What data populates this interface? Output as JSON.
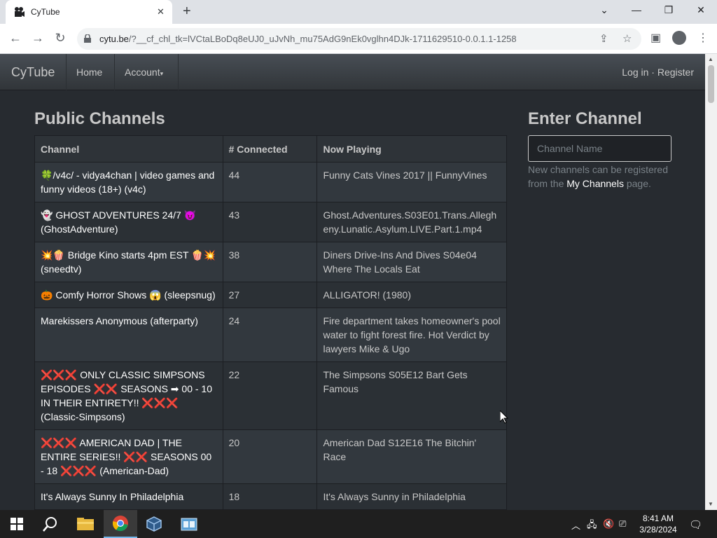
{
  "browser": {
    "tab_title": "CyTube",
    "url_host": "cytu.be",
    "url_path": "/?__cf_chl_tk=lVCtaLBoDq8eUJ0_uJvNh_mu75AdG9nEk0vglhn4DJk-1711629510-0.0.1.1-1258"
  },
  "navbar": {
    "brand": "CyTube",
    "home": "Home",
    "account": "Account",
    "login": "Log in",
    "separator": "·",
    "register": "Register"
  },
  "public": {
    "heading": "Public Channels",
    "columns": [
      "Channel",
      "# Connected",
      "Now Playing"
    ],
    "rows": [
      {
        "emoji_pre": "🍀",
        "name": "/v4c/ - vidya4chan | video games and funny videos (18+) (v4c)",
        "connected": "44",
        "now_playing": "Funny Cats Vines 2017 || FunnyVines"
      },
      {
        "emoji_pre": "👻",
        "name": "GHOST ADVENTURES 24/7 😈 (GhostAdventure)",
        "connected": "43",
        "now_playing": "Ghost.Adventures.S03E01.Trans.Allegheny.Lunatic.Asylum.LIVE.Part.1.mp4"
      },
      {
        "emoji_pre": "💥🍿",
        "name": "Bridge Kino starts 4pm EST 🍿💥 (sneedtv)",
        "connected": "38",
        "now_playing": "Diners Drive-Ins And Dives S04e04 Where The Locals Eat"
      },
      {
        "emoji_pre": "🎃",
        "name": "Comfy Horror Shows 😱 (sleepsnug)",
        "connected": "27",
        "now_playing": "ALLIGATOR! (1980)"
      },
      {
        "emoji_pre": "",
        "name": "Marekissers Anonymous (afterparty)",
        "connected": "24",
        "now_playing": "Fire department takes homeowner's pool water to fight forest fire. Hot Verdict by lawyers Mike & Ugo"
      },
      {
        "emoji_pre": "❌❌❌",
        "name": "ONLY CLASSIC SIMPSONS EPISODES ❌❌ SEASONS ➡ 00 - 10 IN THEIR ENTIRETY!! ❌❌❌ (Classic-Simpsons)",
        "connected": "22",
        "now_playing": "The Simpsons S05E12 Bart Gets Famous"
      },
      {
        "emoji_pre": "❌❌❌",
        "name": "AMERICAN DAD | THE ENTIRE SERIES!! ❌❌ SEASONS 00 - 18 ❌❌❌ (American-Dad)",
        "connected": "20",
        "now_playing": "American Dad S12E16 The Bitchin' Race"
      },
      {
        "emoji_pre": "",
        "name": "It's Always Sunny In Philadelphia",
        "connected": "18",
        "now_playing": "It's Always Sunny in Philadelphia"
      }
    ]
  },
  "enter": {
    "heading": "Enter Channel",
    "placeholder": "Channel Name",
    "help_prefix": "New channels can be registered from the",
    "help_link": "My Channels",
    "help_suffix": "page."
  },
  "taskbar": {
    "time": "8:41 AM",
    "date": "3/28/2024"
  }
}
